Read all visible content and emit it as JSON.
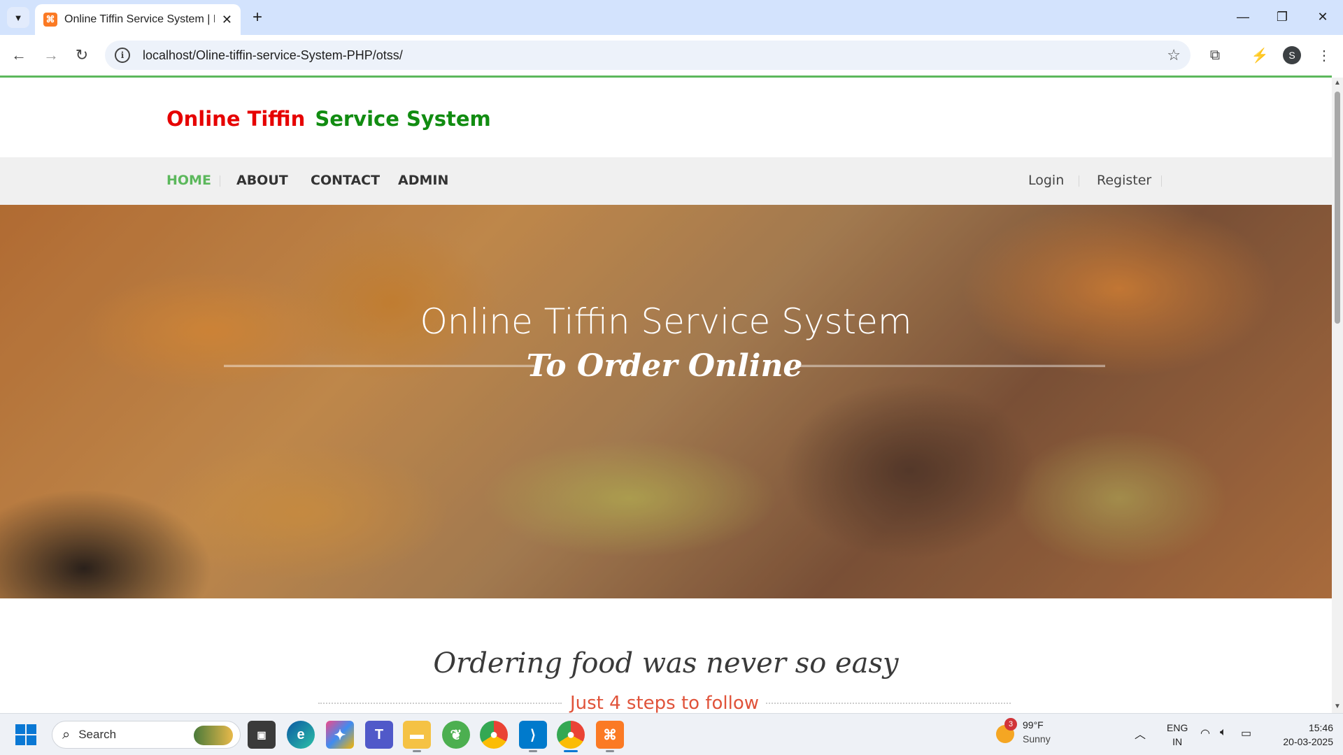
{
  "browser": {
    "tab_title": "Online Tiffin Service System | Home",
    "tab_close": "✕",
    "new_tab": "+",
    "url": "localhost/Oline-tiffin-service-System-PHP/otss/",
    "profile_initial": "S",
    "window_controls": {
      "minimize": "—",
      "restore": "❐",
      "close": "✕"
    }
  },
  "site": {
    "brand_part1": "Online Tiffin",
    "brand_part2": "Service System",
    "brand_colors": {
      "part1": "#e60000",
      "part2": "#118c11"
    },
    "accent_color": "#5cb85c"
  },
  "nav": {
    "items": [
      {
        "label": "HOME",
        "active": true
      },
      {
        "label": "ABOUT"
      },
      {
        "label": "CONTACT"
      },
      {
        "label": "ADMIN"
      }
    ],
    "login": "Login",
    "register": "Register"
  },
  "hero": {
    "title": "Online Tiffin Service System",
    "subtitle": "To Order Online"
  },
  "section": {
    "title": "Ordering food was never so easy",
    "subtitle": "Just 4 steps to follow"
  },
  "taskbar": {
    "search_placeholder": "Search",
    "weather_badge": "3",
    "weather_temp": "99°F",
    "weather_condition": "Sunny",
    "lang_line1": "ENG",
    "lang_line2": "IN",
    "time": "15:46",
    "date": "20-03-2025"
  }
}
